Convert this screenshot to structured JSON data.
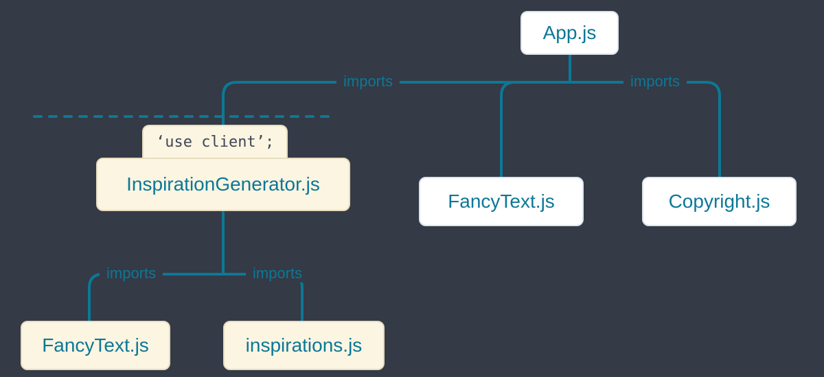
{
  "nodes": {
    "root": "App.js",
    "inspiration_generator": "InspirationGenerator.js",
    "fancy_text_right": "FancyText.js",
    "copyright": "Copyright.js",
    "fancy_text_left": "FancyText.js",
    "inspirations": "inspirations.js"
  },
  "directive": "‘use client’;",
  "edges": {
    "app_to_inspiration": "imports",
    "app_to_copyright": "imports",
    "ig_to_fancytext": "imports",
    "ig_to_inspirations": "imports"
  }
}
